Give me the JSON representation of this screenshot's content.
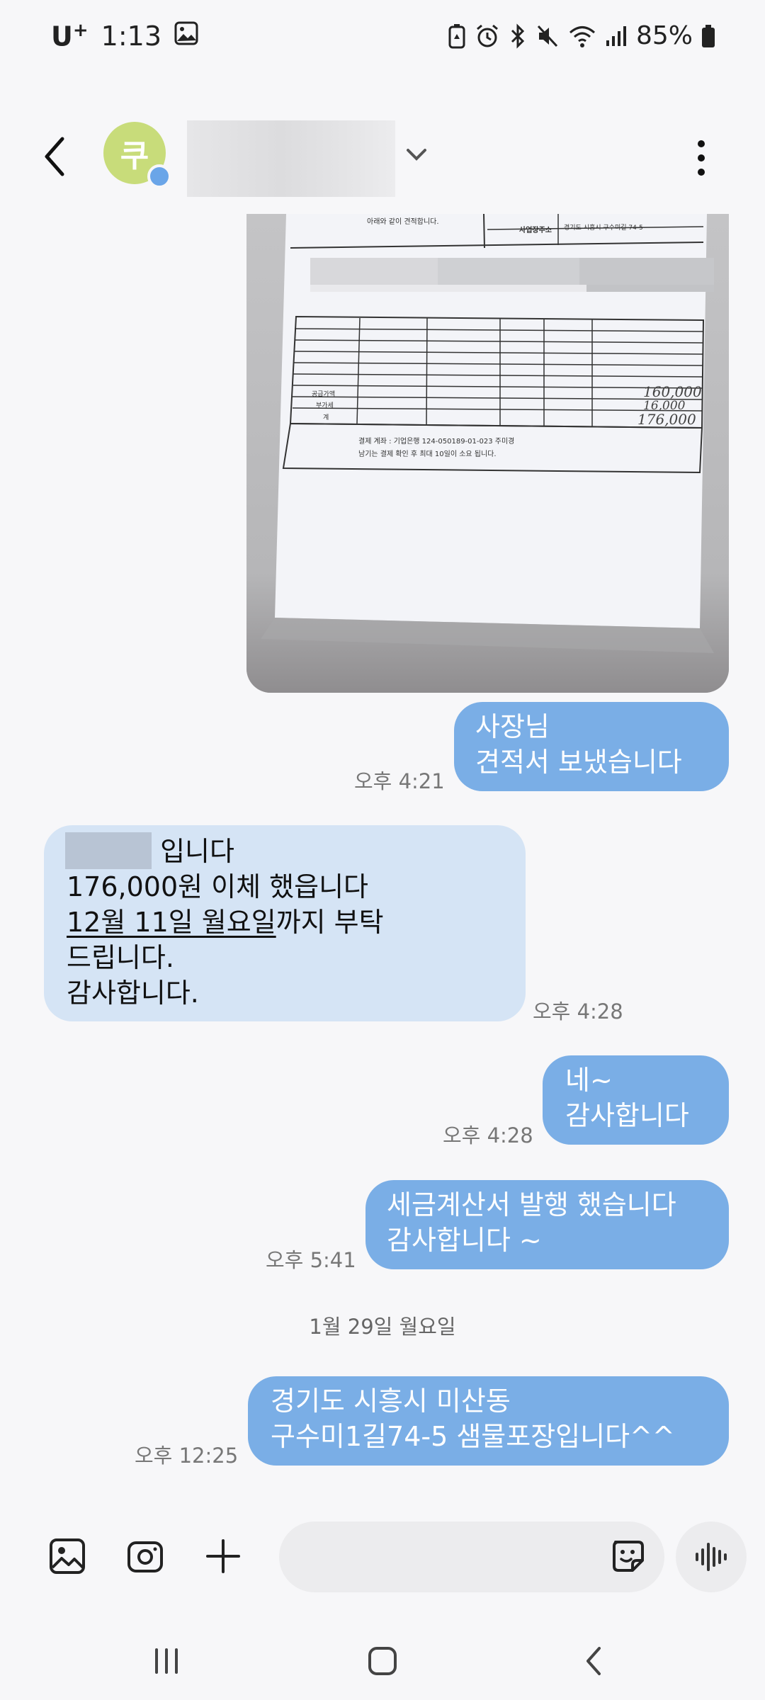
{
  "status_bar": {
    "carrier": "U",
    "carrier_plus": "+",
    "time": "1:13",
    "battery": "85%"
  },
  "header": {
    "avatar_letter": "쿠"
  },
  "messages": {
    "m1": {
      "text": "사장님\n견적서 보냈습니다",
      "time": "오후 4:21"
    },
    "m2": {
      "line1_suffix": " 입니다",
      "line2": "176,000원 이체 했읍니다",
      "line3_underlined": "12월 11일 월요일",
      "line3_rest": "까지 부탁",
      "line4": "드립니다.",
      "line5": "감사합니다.",
      "time": "오후 4:28"
    },
    "m3": {
      "text": "네~\n감사합니다",
      "time": "오후 4:28"
    },
    "m4": {
      "text": "세금계산서 발행 했습니다\n감사합니다 ~",
      "time": "오후 5:41"
    },
    "date_separator": "1월 29일 월요일",
    "m5": {
      "text": "경기도 시흥시 미산동\n구수미1길74-5 샘물포장입니다^^",
      "time": "오후 12:25"
    }
  },
  "photo_document": {
    "row_label_1": "공급가액",
    "row_label_2": "부가세",
    "row_label_3": "계",
    "account_line": "결제 계좌 : 기업은행 124-050189-01-023 주미경",
    "note_line": "남기는 결제 확인 후 최대 10일이 소요 됩니다.",
    "header_text_1": "아래와 같이 견적합니다.",
    "header_label": "사업장주소",
    "header_value": "경기도 시흥시 구수미길 74-5",
    "handwritten_1": "160,000",
    "handwritten_2": "16,000",
    "handwritten_3": "176,000"
  },
  "input": {
    "placeholder": ""
  },
  "colors": {
    "outgoing_bubble": "#7aaee6",
    "incoming_bubble": "#d5e4f5",
    "avatar": "#c8dc7a"
  }
}
